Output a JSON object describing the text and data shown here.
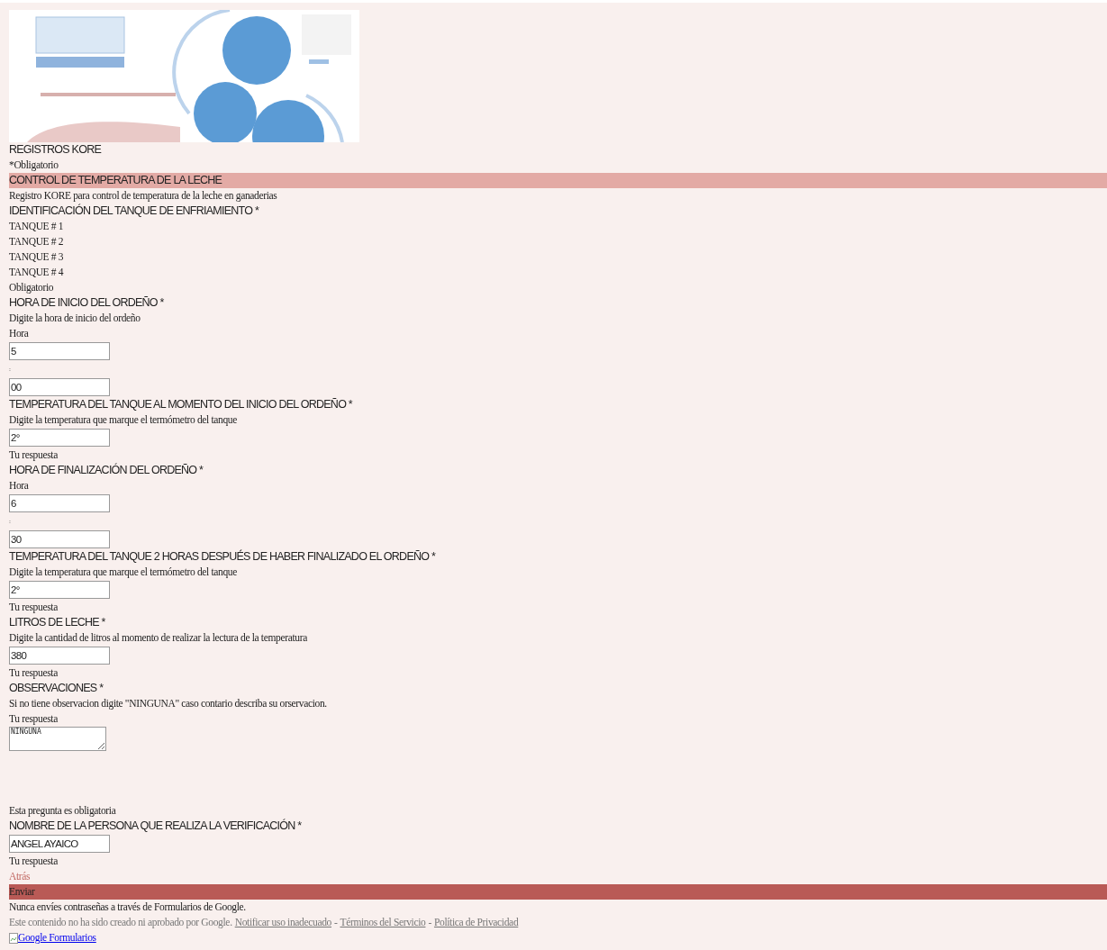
{
  "form_title": "REGISTROS KORE",
  "required_note": "*Obligatorio",
  "section": {
    "title": "CONTROL DE TEMPERATURA DE LA LECHE",
    "description": "Registro KORE para control de temperatura de la leche en ganaderias"
  },
  "items": [
    {
      "kind": "heading",
      "text": "IDENTIFICACIÓN DEL TANQUE DE ENFRIAMIENTO *"
    },
    {
      "kind": "option",
      "text": "TANQUE # 1"
    },
    {
      "kind": "option",
      "text": "TANQUE # 2"
    },
    {
      "kind": "option",
      "text": "TANQUE # 3"
    },
    {
      "kind": "option",
      "text": "TANQUE # 4"
    },
    {
      "kind": "text",
      "text": "Obligatorio"
    },
    {
      "kind": "heading",
      "text": "HORA DE INICIO DEL ORDEÑO *"
    },
    {
      "kind": "text",
      "text": "Digite la hora de inicio del ordeño"
    },
    {
      "kind": "text",
      "text": "Hora"
    },
    {
      "kind": "field",
      "value": "5"
    },
    {
      "kind": "colon",
      "text": ":"
    },
    {
      "kind": "field",
      "value": "00"
    },
    {
      "kind": "heading",
      "text": "TEMPERATURA DEL TANQUE AL MOMENTO DEL INICIO DEL ORDEÑO *"
    },
    {
      "kind": "text",
      "text": "Digite la temperatura que marque el termómetro del tanque"
    },
    {
      "kind": "field",
      "value": "2°"
    },
    {
      "kind": "text",
      "text": "Tu respuesta"
    },
    {
      "kind": "heading",
      "text": "HORA DE FINALIZACIÓN DEL ORDEÑO *"
    },
    {
      "kind": "text",
      "text": "Hora"
    },
    {
      "kind": "field",
      "value": "6"
    },
    {
      "kind": "colon",
      "text": ":"
    },
    {
      "kind": "field",
      "value": "30"
    },
    {
      "kind": "heading",
      "text": "TEMPERATURA DEL TANQUE 2 HORAS DESPUÉS DE HABER FINALIZADO EL ORDEÑO *"
    },
    {
      "kind": "text",
      "text": "Digite la temperatura que marque el termómetro del tanque"
    },
    {
      "kind": "field",
      "value": "2°"
    },
    {
      "kind": "text",
      "text": "Tu respuesta"
    },
    {
      "kind": "heading",
      "text": "LITROS DE LECHE *"
    },
    {
      "kind": "text",
      "text": "Digite la cantidad de litros al momento de realizar la lectura de la temperatura"
    },
    {
      "kind": "field",
      "value": "380"
    },
    {
      "kind": "text",
      "text": "Tu respuesta"
    },
    {
      "kind": "heading",
      "text": "OBSERVACIONES *"
    },
    {
      "kind": "text",
      "text": "Si no tiene observacion digite \"NINGUNA\" caso contario describa su orservacion."
    },
    {
      "kind": "text",
      "text": "Tu respuesta"
    },
    {
      "kind": "textarea",
      "value": "NINGUNA"
    },
    {
      "kind": "error",
      "text": "Esta pregunta es obligatoria"
    },
    {
      "kind": "heading",
      "text": "NOMBRE DE LA PERSONA QUE REALIZA LA VERIFICACIÓN *"
    },
    {
      "kind": "field",
      "value": "ANGEL AYAICO"
    },
    {
      "kind": "text",
      "text": "Tu respuesta"
    }
  ],
  "back_link": "Atrás",
  "submit_button": "Enviar",
  "password_warning": "Nunca envíes contraseñas a través de Formularios de Google.",
  "disclaimer": {
    "text": "Este contenido no ha sido creado ni aprobado por Google.",
    "links": [
      "Notificar uso inadecuado",
      "Términos del Servicio",
      "Política de Privacidad"
    ],
    "separator": "-"
  },
  "logo_link": "Google Formularios"
}
